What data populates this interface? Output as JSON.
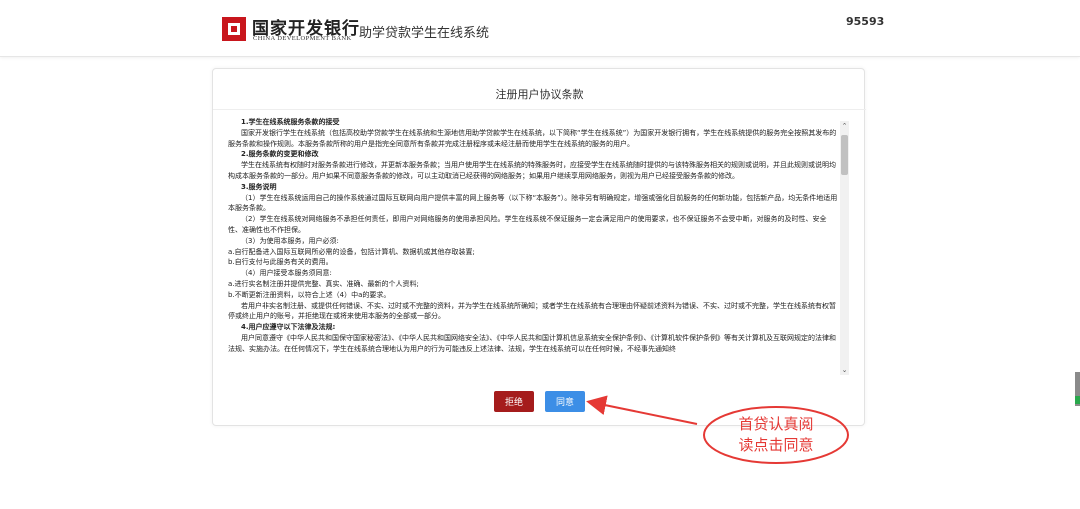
{
  "header": {
    "brand_cn": "国家开发银行",
    "brand_en": "CHINA DEVELOPMENT BANK",
    "system_title": "助学贷款学生在线系统",
    "hotline": "95593"
  },
  "dialog": {
    "title": "注册用户协议条款",
    "terms": [
      {
        "type": "h",
        "text": "1.学生在线系统服务条款的接受"
      },
      {
        "type": "p",
        "text": "国家开发银行学生在线系统（包括高校助学贷款学生在线系统和生源地信用助学贷款学生在线系统，以下简称“学生在线系统”）为国家开发银行拥有，学生在线系统提供的服务完全按照其发布的服务条款和操作规则。本服务条款所称的用户是指完全同意所有条款并完成注册程序或未经注册而使用学生在线系统的服务的用户。"
      },
      {
        "type": "h",
        "text": "2.服务条款的变更和修改"
      },
      {
        "type": "p",
        "text": "学生在线系统有权随时对服务条款进行修改，并更新本服务条款；当用户使用学生在线系统的特殊服务时，应接受学生在线系统随时提供的与该特殊服务相关的规则或说明，并且此规则或说明均构成本服务条款的一部分。用户如果不同意服务条款的修改，可以主动取消已经获得的网络服务；如果用户继续享用网络服务，则视为用户已经接受服务条款的修改。"
      },
      {
        "type": "h",
        "text": "3.服务说明"
      },
      {
        "type": "p",
        "text": "（1）学生在线系统运用自己的操作系统通过国际互联网向用户提供丰富的网上服务等（以下称“本服务”）。除非另有明确规定，增强或强化目前服务的任何新功能，包括新产品，均无条件地适用本服务条款。"
      },
      {
        "type": "p",
        "text": "（2）学生在线系统对网络服务不承担任何责任，即用户对网络服务的使用承担风险。学生在线系统不保证服务一定会满足用户的使用要求，也不保证服务不会受中断，对服务的及时性、安全性、准确性也不作担保。"
      },
      {
        "type": "p",
        "text": "（3）为使用本服务，用户必须:"
      },
      {
        "type": "l",
        "text": "a.自行配备进入国际互联网所必需的设备，包括计算机、数据机或其他存取装置;"
      },
      {
        "type": "l",
        "text": "b.自行支付与此服务有关的费用。"
      },
      {
        "type": "p",
        "text": "（4）用户接受本服务须同意:"
      },
      {
        "type": "l",
        "text": "a.进行实名制注册并提供完整、真实、准确、最新的个人资料;"
      },
      {
        "type": "l",
        "text": "b.不断更新注册资料，以符合上述（4）中a的要求。"
      },
      {
        "type": "p",
        "text": "若用户非实名制注册、或提供任何错误、不实、过时或不完整的资料，并为学生在线系统所确知；或者学生在线系统有合理理由怀疑前述资料为错误、不实、过时或不完整，学生在线系统有权暂停或终止用户的账号，并拒绝现在或将来使用本服务的全部或一部分。"
      },
      {
        "type": "h",
        "text": "4.用户应遵守以下法律及法规:"
      },
      {
        "type": "p",
        "text": "用户同意遵守《中华人民共和国保守国家秘密法》、《中华人民共和国网络安全法》、《中华人民共和国计算机信息系统安全保护条例》、《计算机软件保护条例》等有关计算机及互联网规定的法律和法规、实施办法。在任何情况下，学生在线系统合理地认为用户的行为可能违反上述法律、法规，学生在线系统可以在任何时候，不经事先通知终"
      }
    ],
    "reject_label": "拒绝",
    "agree_label": "同意"
  },
  "annotation": {
    "line1": "首贷认真阅",
    "line2": "读点击同意",
    "color": "#e53935"
  },
  "colors": {
    "brand_red": "#c8161d",
    "reject_button": "#a51c1c",
    "agree_button": "#3c8ee6"
  }
}
